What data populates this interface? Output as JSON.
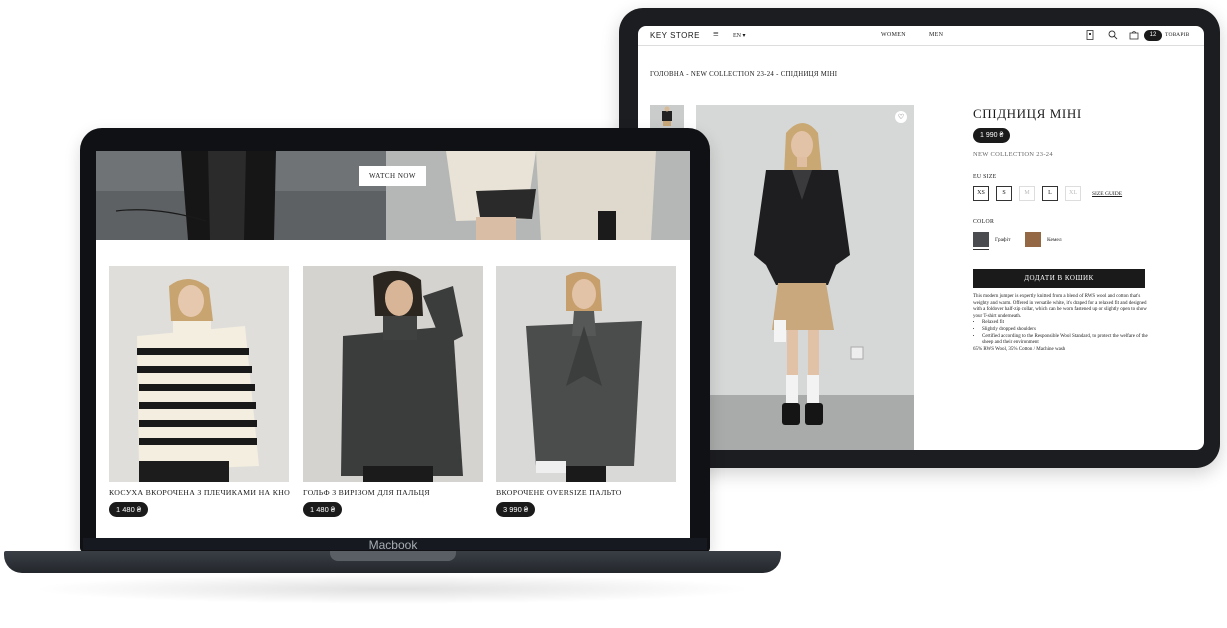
{
  "tablet": {
    "header": {
      "logo": "KEY STORE",
      "language": "EN ▾",
      "nav": [
        "WOMEN",
        "MEN"
      ],
      "cart_count": "12",
      "cart_label": "ТОВАРІВ",
      "icons": [
        "menu-icon",
        "user-icon",
        "search-icon",
        "bag-icon"
      ]
    },
    "breadcrumb": "ГОЛОВНА - NEW COLLECTION 23-24 - СПІДНИЦЯ МІНІ",
    "product": {
      "title": "СПІДНИЦЯ МІНІ",
      "price": "1 990 ₴",
      "collection": "NEW COLLECTION 23-24",
      "size_label": "EU SIZE",
      "sizes": [
        {
          "label": "XS",
          "available": true
        },
        {
          "label": "S",
          "available": true
        },
        {
          "label": "M",
          "available": false
        },
        {
          "label": "L",
          "available": true
        },
        {
          "label": "XL",
          "available": false
        }
      ],
      "size_guide": "SIZE GUIDE",
      "color_label": "COLOR",
      "colors": [
        {
          "name": "Графіт",
          "hex": "#4a4c4f"
        },
        {
          "name": "Кемел",
          "hex": "#946844"
        }
      ],
      "add_to_cart": "ДОДАТИ В КОШИК",
      "description": "This modern jumper is expertly knitted from a blend of RWS wool and cotton that's weighty and warm. Offered in versatile white, it's draped for a relaxed fit and designed with a foldover half-zip collar, which can be worn fastened up or slightly open to show your T-shirt underneath.",
      "bullets": [
        "Relaxed fit",
        "Slightly dropped shoulders",
        "Certified according to the Responsible Wool Standard, to protect the welfare of the sheep and their environment"
      ],
      "composition": "65% RWS Wool, 35% Cotton / Machine wash"
    }
  },
  "laptop": {
    "label": "Macbook",
    "banner_button": "WATCH NOW",
    "products": [
      {
        "name": "КОСУХА ВКОРОЧЕНА З ПЛЕЧИКАМИ НА КНО",
        "price": "1 480 ₴"
      },
      {
        "name": "ГОЛЬФ З ВИРІЗОМ ДЛЯ ПАЛЬЦЯ",
        "price": "1 480 ₴"
      },
      {
        "name": "ВКОРОЧЕНЕ OVERSIZE ПАЛЬТО",
        "price": "3 990 ₴"
      }
    ]
  },
  "colors": {
    "dark": "#1a1a1a",
    "device_frame": "#1c1d20"
  }
}
